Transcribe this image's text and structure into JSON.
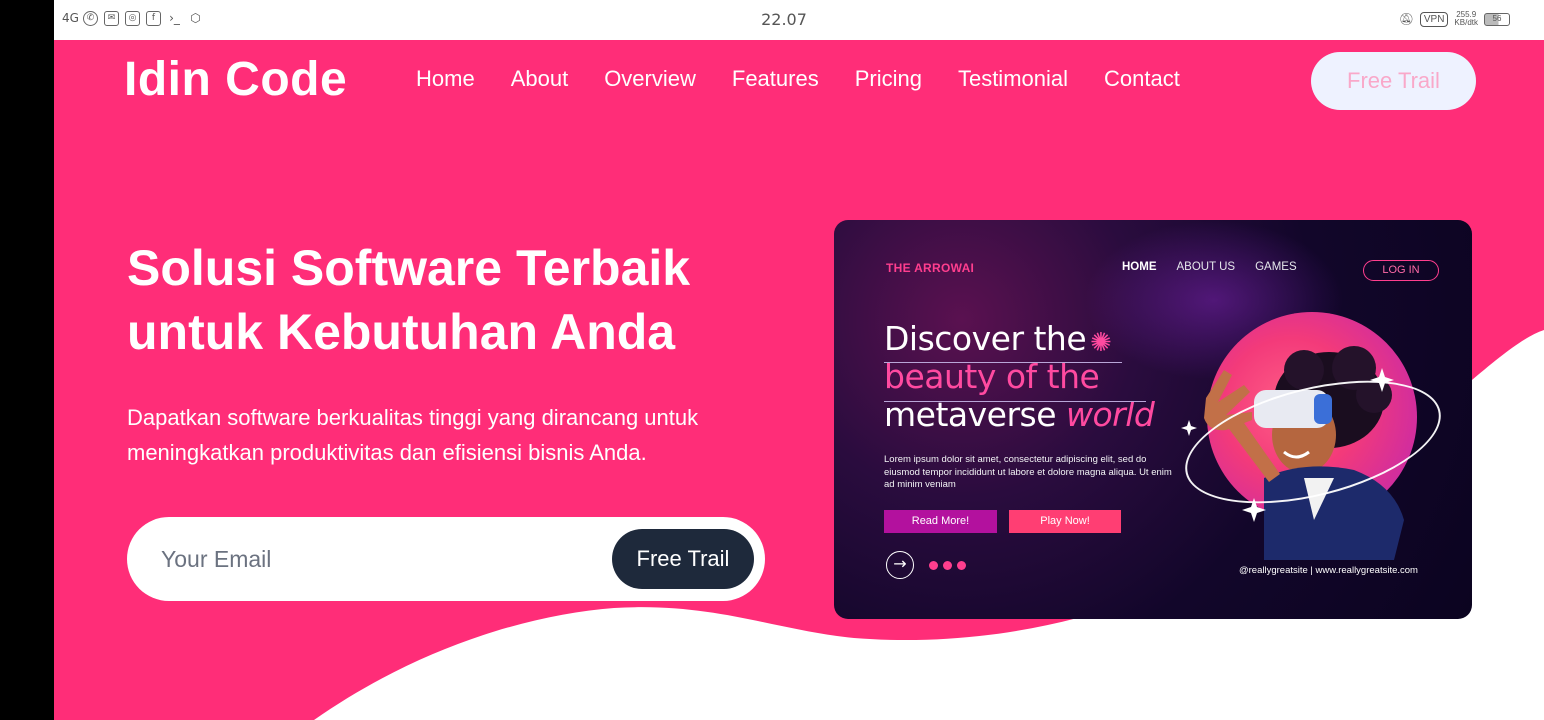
{
  "status_bar": {
    "left_icons": [
      "signal-4g",
      "whatsapp",
      "gmail",
      "instagram",
      "facebook",
      "terminal",
      "settings"
    ],
    "network_label": "4G",
    "time": "22.07",
    "vpn": "VPN",
    "speed_value": "255.9",
    "speed_unit": "KB/dtk",
    "battery": "56"
  },
  "header": {
    "brand": "Idin Code",
    "nav": [
      "Home",
      "About",
      "Overview",
      "Features",
      "Pricing",
      "Testimonial",
      "Contact"
    ],
    "cta": "Free Trail"
  },
  "hero": {
    "headline": "Solusi Software Terbaik untuk Kebutuhan Anda",
    "subtext": "Dapatkan software berkualitas tinggi yang dirancang untuk meningkatkan produktivitas dan efisiensi bisnis Anda.",
    "email_placeholder": "Your Email",
    "email_button": "Free Trail"
  },
  "promo_image": {
    "brand": "THE ARROWAI",
    "nav": [
      "HOME",
      "ABOUT US",
      "GAMES"
    ],
    "login": "LOG IN",
    "line1": "Discover the",
    "line2": "beauty of the",
    "line3_a": "metaverse ",
    "line3_b": "world",
    "body": "Lorem ipsum dolor sit amet, consectetur adipiscing elit, sed do eiusmod tempor incididunt ut labore et dolore magna aliqua. Ut enim ad minim veniam",
    "button1": "Read More!",
    "button2": "Play Now!",
    "footer": "@reallygreatsite | www.reallygreatsite.com"
  },
  "colors": {
    "hero_bg": "#ff2d78",
    "dark_button": "#1e293b",
    "cta_bg": "#eef2ff"
  }
}
